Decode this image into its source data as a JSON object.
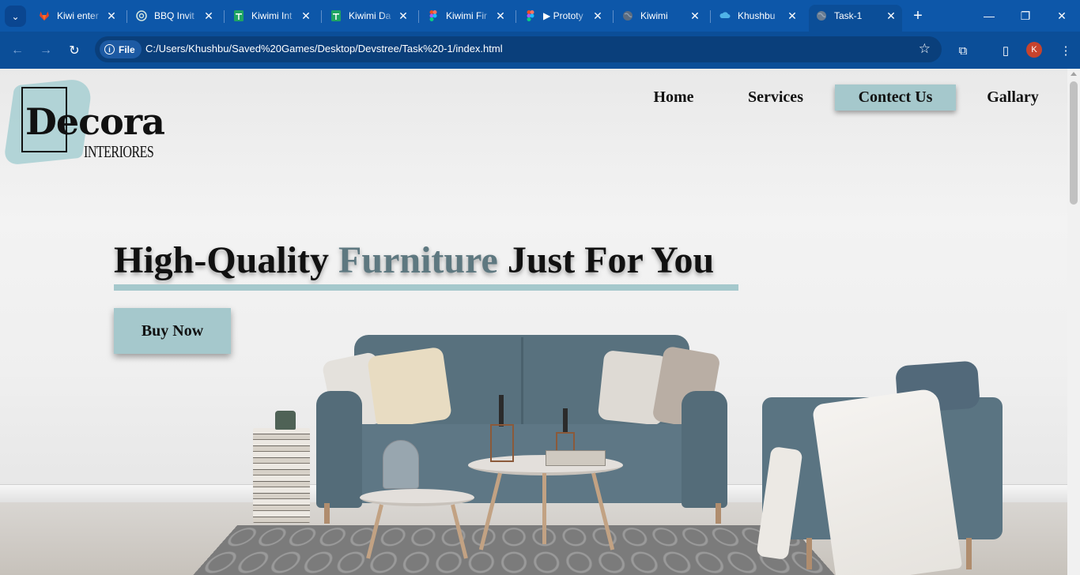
{
  "browser": {
    "tabs": [
      {
        "title": "Kiwi enter",
        "icon": "gitlab-icon"
      },
      {
        "title": "BBQ Invit",
        "icon": "openai-icon"
      },
      {
        "title": "Kiwimi Int",
        "icon": "sheets-icon"
      },
      {
        "title": "Kiwimi Da",
        "icon": "sheets-icon"
      },
      {
        "title": "Kiwimi Fir",
        "icon": "figma-icon"
      },
      {
        "title": "▶ Prototy",
        "icon": "figma-icon"
      },
      {
        "title": "Kiwimi",
        "icon": "globe-icon"
      },
      {
        "title": "Khushbu",
        "icon": "cloud-icon"
      },
      {
        "title": "Task-1",
        "icon": "globe-icon",
        "active": true
      }
    ],
    "address": {
      "chip_label": "File",
      "url": "C:/Users/Khushbu/Saved%20Games/Desktop/Devstree/Task%20-1/index.html"
    },
    "profile_initial": "K",
    "colors": {
      "frame": "#0d57a9",
      "toolbar": "#0b4e98"
    }
  },
  "site": {
    "logo": {
      "word": "Decora",
      "sub": "INTERIORES"
    },
    "nav": [
      {
        "label": "Home"
      },
      {
        "label": "Services"
      },
      {
        "label": "Contect Us",
        "active": true
      },
      {
        "label": "Gallary"
      }
    ],
    "hero": {
      "title_part1": "High-Quality ",
      "title_accent": "Furniture",
      "title_part2": " Just For You",
      "cta": "Buy Now"
    },
    "colors": {
      "accent": "#a5c8cc",
      "accent_text": "#5e7880",
      "text": "#111111"
    }
  }
}
